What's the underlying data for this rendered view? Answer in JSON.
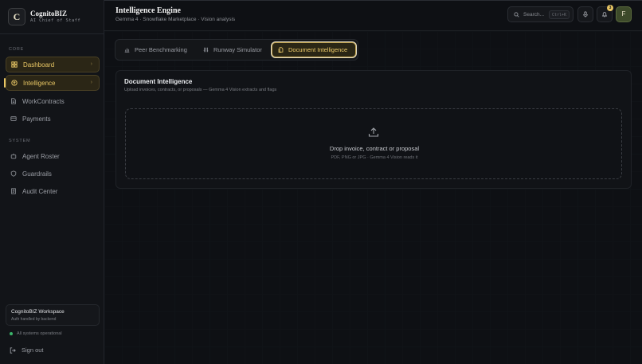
{
  "brand": {
    "logo_letter": "C",
    "name": "CognitoBIZ",
    "tagline": "AI Chief of Staff"
  },
  "sidebar": {
    "sections": [
      {
        "label": "CORE",
        "items": [
          {
            "label": "Dashboard",
            "icon": "grid-icon",
            "active": true
          },
          {
            "label": "Intelligence",
            "icon": "brain-icon",
            "active": true
          },
          {
            "label": "WorkContracts",
            "icon": "document-icon",
            "active": false
          },
          {
            "label": "Payments",
            "icon": "card-icon",
            "active": false
          }
        ]
      },
      {
        "label": "SYSTEM",
        "items": [
          {
            "label": "Agent Roster",
            "icon": "bot-icon",
            "active": false
          },
          {
            "label": "Guardrails",
            "icon": "shield-icon",
            "active": false
          },
          {
            "label": "Audit Center",
            "icon": "audit-icon",
            "active": false
          }
        ]
      }
    ],
    "chevron": "›",
    "workspace": {
      "title": "CognitoBIZ Workspace",
      "subtitle": "Auth handled by backend"
    },
    "status": "All systems operational",
    "signout": "Sign out"
  },
  "header": {
    "title": "Intelligence Engine",
    "subtitle": "Gemma 4 · Snowflake Marketplace · Vision analysis",
    "search_placeholder": "Search...",
    "search_shortcut": "Ctrl+K",
    "notification_count": "3",
    "avatar_letter": "F"
  },
  "tabs": [
    {
      "label": "Peer Benchmarking",
      "icon": "bar-chart-icon",
      "active": false
    },
    {
      "label": "Runway Simulator",
      "icon": "sliders-icon",
      "active": false
    },
    {
      "label": "Document Intelligence",
      "icon": "file-icon",
      "active": true
    }
  ],
  "card": {
    "title": "Document Intelligence",
    "subtitle": "Upload invoices, contracts, or proposals — Gemma 4 Vision extracts and flags",
    "dropzone_title": "Drop invoice, contract or proposal",
    "dropzone_sub": "PDF, PNG or JPG · Gemma 4 Vision reads it"
  },
  "colors": {
    "background": "#0e1014",
    "accent": "#e8c664",
    "status_ok": "#3bb66b"
  }
}
